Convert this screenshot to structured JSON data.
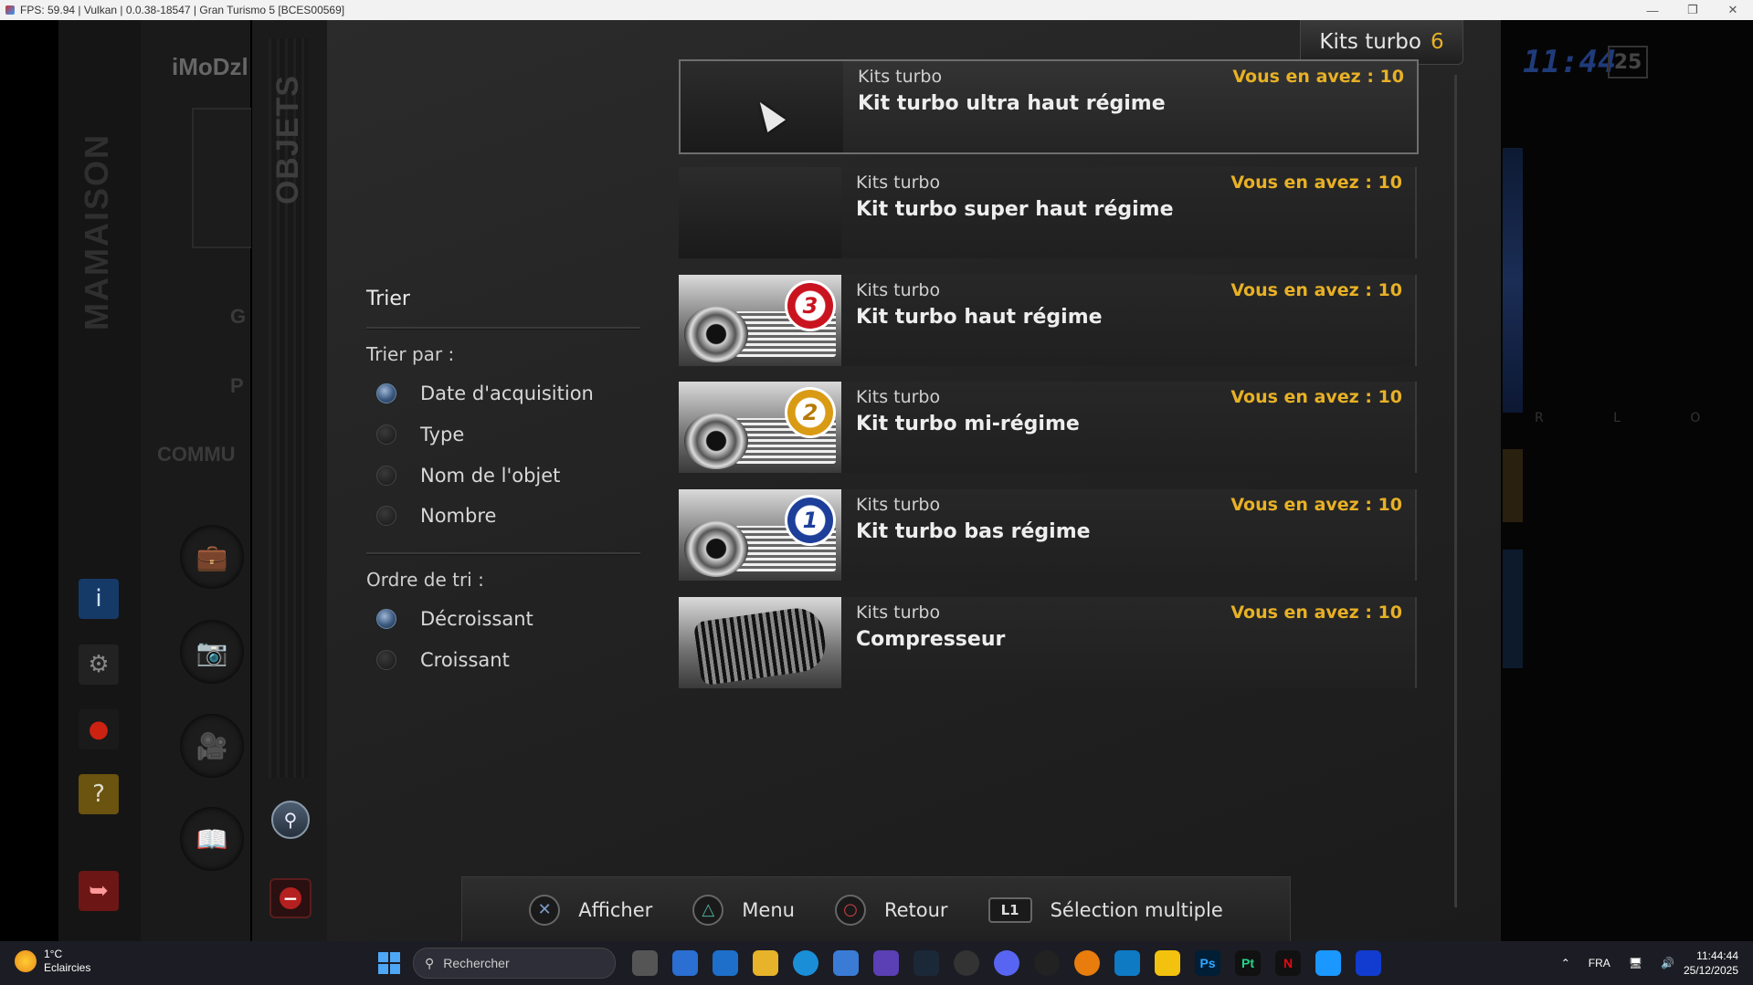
{
  "window": {
    "title": "FPS: 59.94 | Vulkan | 0.0.38-18547 | Gran Turismo 5 [BCES00569]",
    "min": "—",
    "restore": "❐",
    "close": "✕"
  },
  "background": {
    "mamaison": "MAMAISON",
    "profile_name": "iMoDzl",
    "menu_g": "G",
    "menu_p": "P",
    "menu_commu": "COMMU",
    "objets": "OBJETS",
    "clock": "11:44",
    "clock_day": "25",
    "rlo": "R L O"
  },
  "category": {
    "name": "Kits turbo",
    "count": "6"
  },
  "sort": {
    "title": "Trier",
    "by_label": "Trier par :",
    "by_options": [
      "Date d'acquisition",
      "Type",
      "Nom de l'objet",
      "Nombre"
    ],
    "by_selected": 0,
    "order_label": "Ordre de tri :",
    "order_options": [
      "Décroissant",
      "Croissant"
    ],
    "order_selected": 0
  },
  "items": [
    {
      "category": "Kits turbo",
      "name": "Kit turbo ultra haut régime",
      "owned": "Vous en avez : 10",
      "badge": ""
    },
    {
      "category": "Kits turbo",
      "name": "Kit turbo super haut régime",
      "owned": "Vous en avez : 10",
      "badge": ""
    },
    {
      "category": "Kits turbo",
      "name": "Kit turbo haut régime",
      "owned": "Vous en avez : 10",
      "badge": "3"
    },
    {
      "category": "Kits turbo",
      "name": "Kit turbo mi-régime",
      "owned": "Vous en avez : 10",
      "badge": "2"
    },
    {
      "category": "Kits turbo",
      "name": "Kit turbo bas régime",
      "owned": "Vous en avez : 10",
      "badge": "1"
    },
    {
      "category": "Kits turbo",
      "name": "Compresseur",
      "owned": "Vous en avez : 10",
      "badge": ""
    }
  ],
  "hints": {
    "show": "Afficher",
    "menu": "Menu",
    "back": "Retour",
    "l1_key": "L1",
    "multi": "Sélection multiple"
  },
  "taskbar": {
    "temp": "1°C",
    "weather": "Eclaircies",
    "search": "Rechercher",
    "lang": "FRA",
    "time": "11:44:44",
    "date": "25/12/2025"
  },
  "colors": {
    "accent_gold": "#e8b125",
    "panel": "#262626",
    "selected_radio": "#6b89ad"
  }
}
